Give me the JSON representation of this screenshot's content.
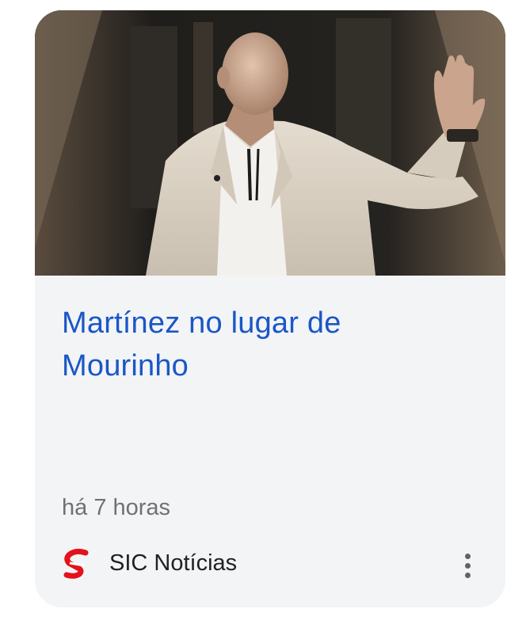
{
  "card": {
    "image": {
      "alt_icon": "news-photo",
      "colors": {
        "background_dark": "#2c2a25",
        "jacket": "#d9d0c3",
        "shirt": "#f2f1ee",
        "skin": "#c9a791"
      }
    },
    "title": "Martínez no lugar de Mourinho",
    "timestamp": "há 7 horas",
    "source": {
      "name": "SIC Notícias",
      "logo_icon": "sic-noticias-logo",
      "logo_color": "#e3121b"
    },
    "more_options_icon": "more-vert-icon"
  },
  "colors": {
    "title": "#1a57c6",
    "card_background": "#f3f4f6",
    "secondary_text": "#6f7176"
  }
}
